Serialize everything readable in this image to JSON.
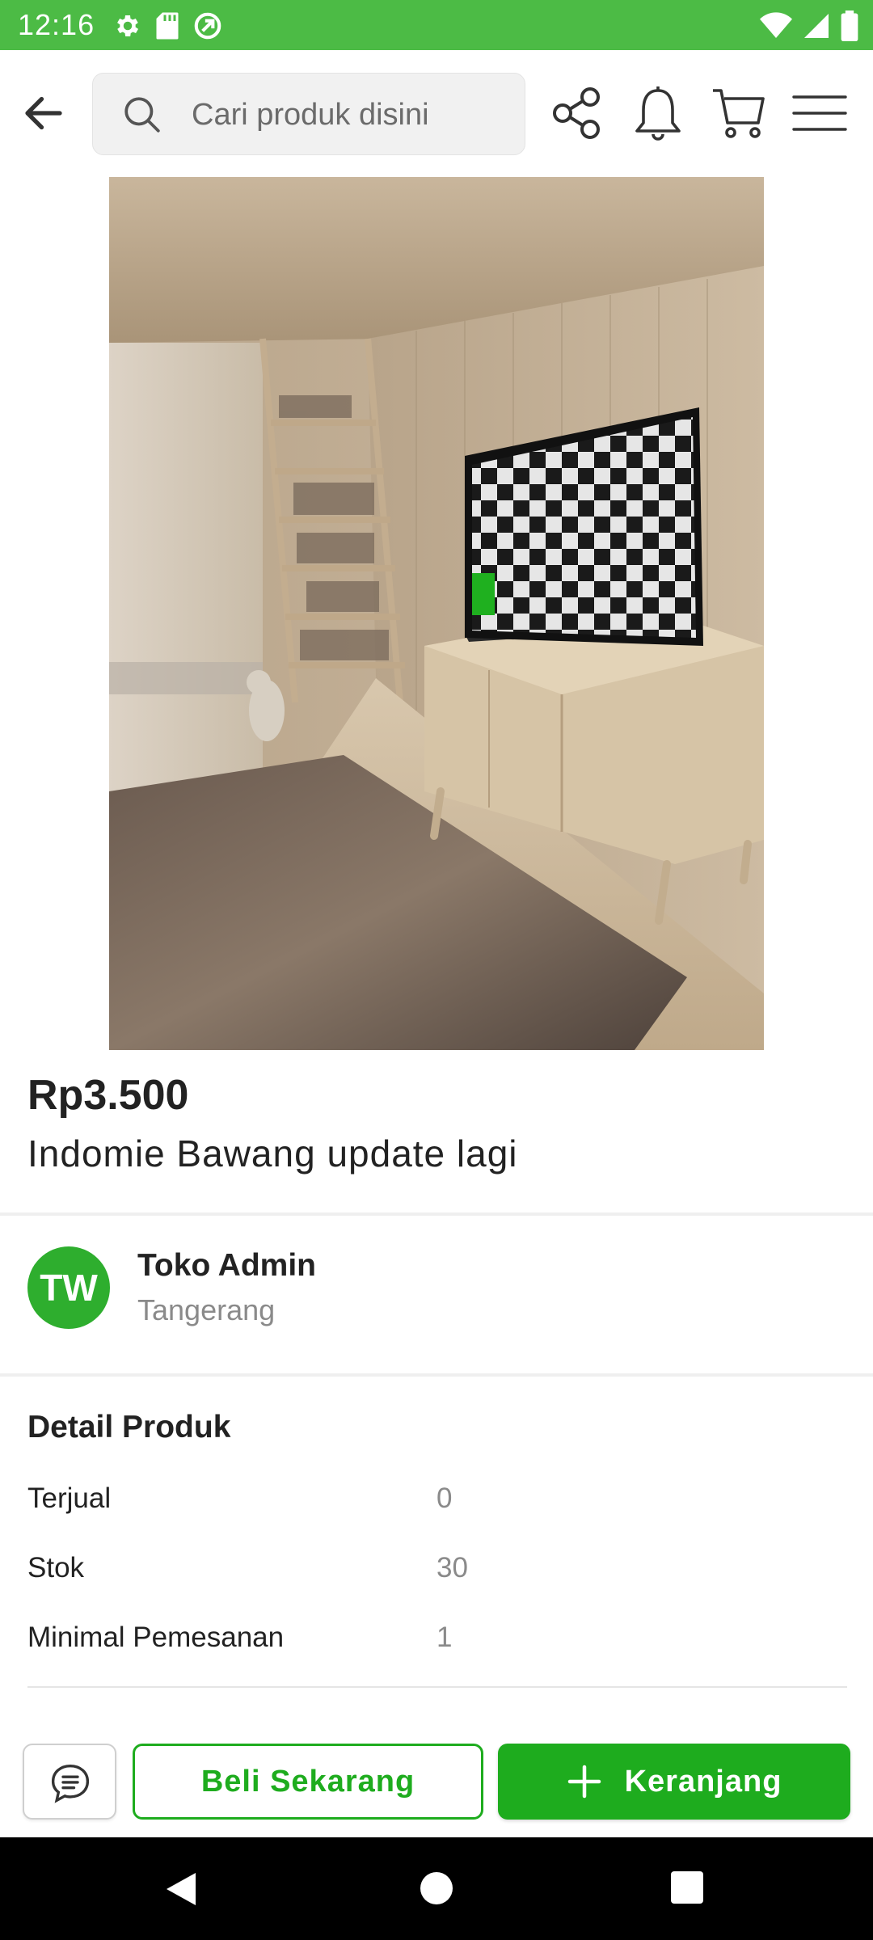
{
  "status_bar": {
    "time": "12:16",
    "background": "#4cbb45",
    "left_icons": [
      "settings-icon",
      "sd-card-icon",
      "data-saver-icon"
    ],
    "right_icons": [
      "wifi-icon",
      "signal-icon",
      "battery-icon"
    ]
  },
  "top_nav": {
    "search_placeholder": "Cari produk disini",
    "icons": [
      "back-arrow-icon",
      "search-icon",
      "share-icon",
      "bell-icon",
      "cart-icon",
      "menu-icon"
    ]
  },
  "product": {
    "price": "Rp3.500",
    "title": "Indomie Bawang update lagi"
  },
  "store": {
    "initials": "TW",
    "name": "Toko Admin",
    "location": "Tangerang",
    "avatar_color": "#2eae2e"
  },
  "details": {
    "header": "Detail Produk",
    "rows": [
      {
        "label": "Terjual",
        "value": "0"
      },
      {
        "label": "Stok",
        "value": "30"
      },
      {
        "label": "Minimal Pemesanan",
        "value": "1"
      }
    ]
  },
  "actions": {
    "buy_now": "Beli Sekarang",
    "add_to_cart": "Keranjang",
    "accent": "#1eac1e"
  },
  "system_nav": [
    "nav-back-icon",
    "nav-home-icon",
    "nav-recents-icon"
  ]
}
